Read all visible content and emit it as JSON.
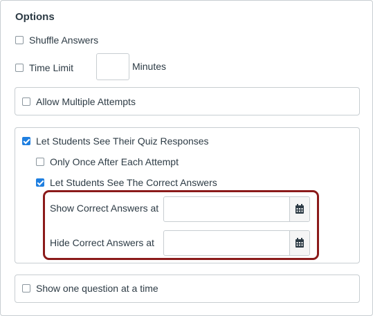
{
  "options": {
    "title": "Options",
    "shuffle_answers": {
      "label": "Shuffle Answers",
      "checked": false
    },
    "time_limit": {
      "label": "Time Limit",
      "checked": false,
      "value": "",
      "units_label": "Minutes"
    },
    "allow_multiple_attempts": {
      "label": "Allow Multiple Attempts",
      "checked": false
    },
    "see_quiz_responses": {
      "label": "Let Students See Their Quiz Responses",
      "checked": true,
      "only_once": {
        "label": "Only Once After Each Attempt",
        "checked": false
      },
      "see_correct_answers": {
        "label": "Let Students See The Correct Answers",
        "checked": true
      },
      "show_correct_at": {
        "label": "Show Correct Answers at",
        "value": ""
      },
      "hide_correct_at": {
        "label": "Hide Correct Answers at",
        "value": ""
      }
    },
    "one_question_at_a_time": {
      "label": "Show one question at a time",
      "checked": false
    }
  },
  "icons": {
    "calendar": "calendar-icon",
    "checkbox": "checkbox-icon"
  },
  "colors": {
    "accent": "#1f7fe0",
    "highlight": "#8b1a1a",
    "border": "#c7cdd1"
  }
}
